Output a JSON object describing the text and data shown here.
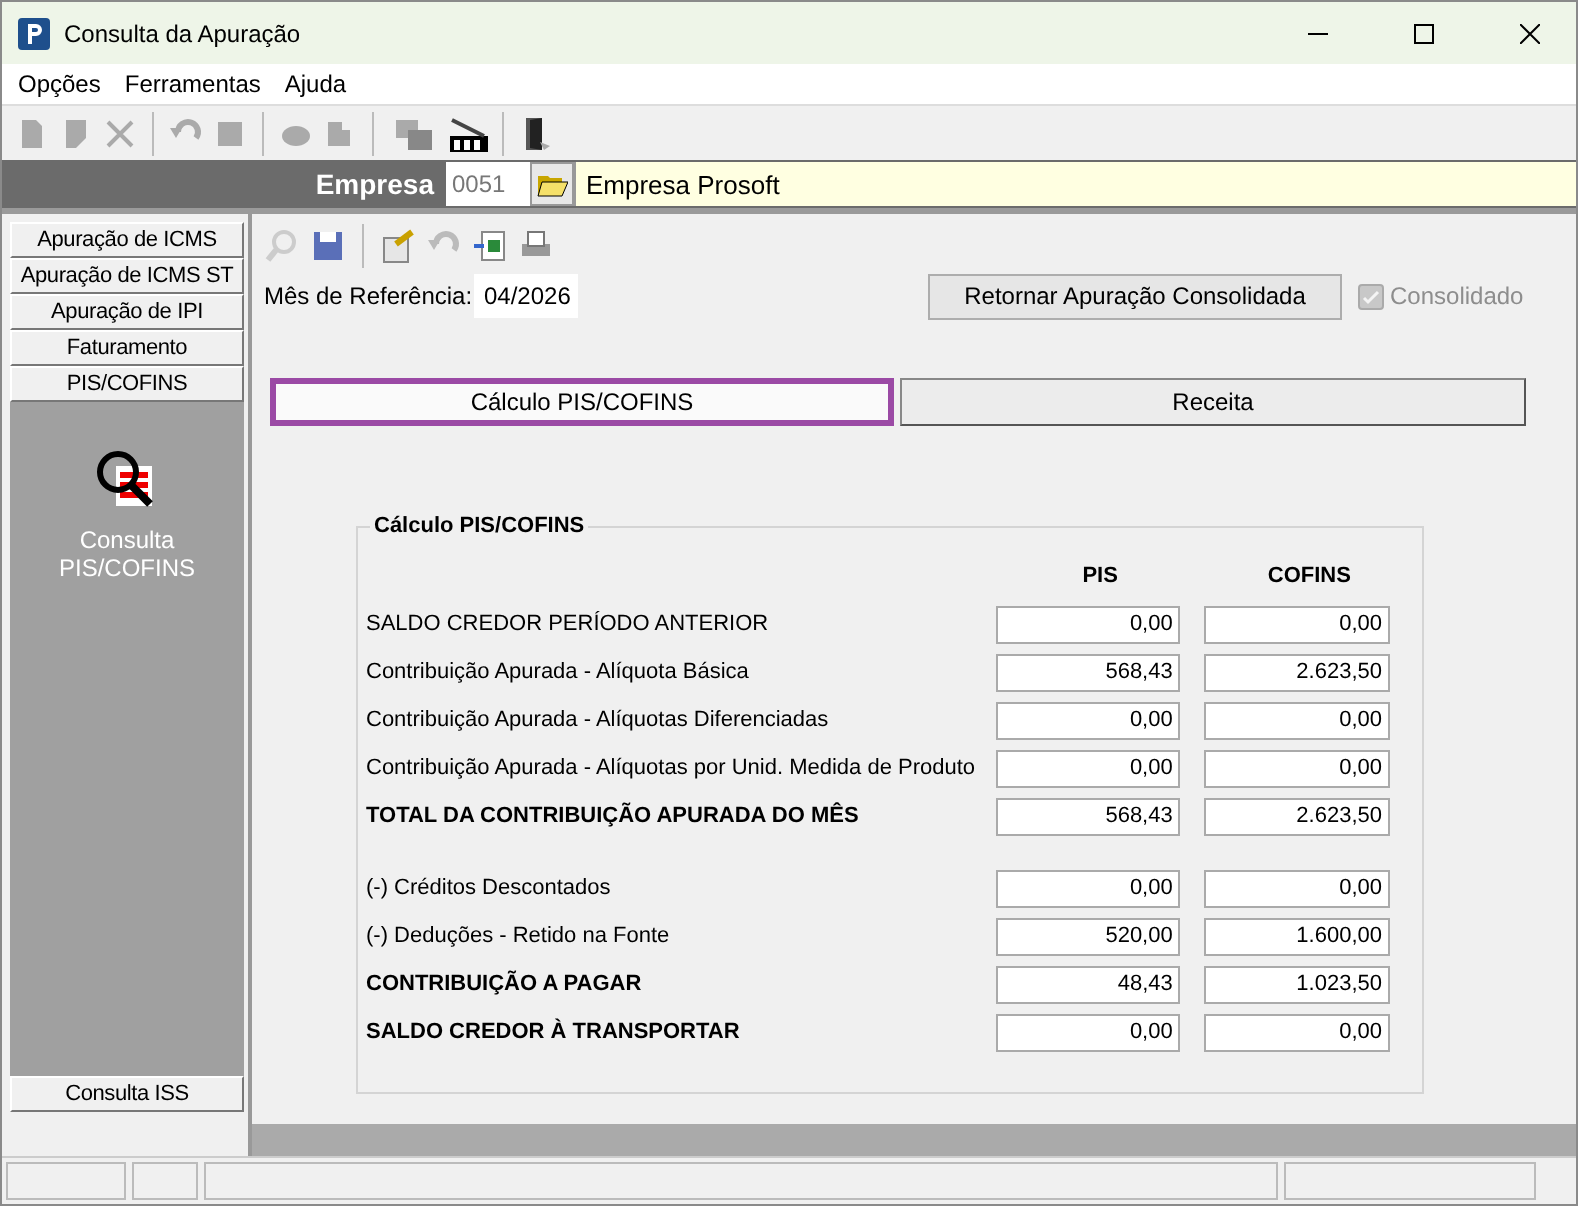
{
  "window": {
    "title": "Consulta da Apuração"
  },
  "menu": [
    "Opções",
    "Ferramentas",
    "Ajuda"
  ],
  "company": {
    "label": "Empresa",
    "code": "0051",
    "name": "Empresa Prosoft"
  },
  "sidebar": {
    "items": [
      "Apuração de ICMS",
      "Apuração de ICMS ST",
      "Apuração de IPI",
      "Faturamento",
      "PIS/COFINS"
    ],
    "panel_items": [
      {
        "label": "Consulta PIS/COFINS"
      }
    ],
    "bottom_items": [
      "Consulta ISS"
    ]
  },
  "reference": {
    "label": "Mês de Referência:",
    "value": "04/2026"
  },
  "return_button": "Retornar Apuração Consolidada",
  "consolidated": {
    "label": "Consolidado",
    "checked": true,
    "disabled": true
  },
  "tabs": [
    {
      "label": "Cálculo PIS/COFINS",
      "selected": true
    },
    {
      "label": "Receita",
      "selected": false
    }
  ],
  "group": {
    "title": "Cálculo PIS/COFINS",
    "columns": [
      "PIS",
      "COFINS"
    ],
    "sections": [
      [
        {
          "label": "SALDO CREDOR PERÍODO ANTERIOR",
          "kind": "normal",
          "pis": "0,00",
          "cofins": "0,00"
        },
        {
          "label": "Contribuição Apurada - Alíquota Básica",
          "kind": "normal",
          "pis": "568,43",
          "cofins": "2.623,50"
        },
        {
          "label": "Contribuição Apurada - Alíquotas Diferenciadas",
          "kind": "normal",
          "pis": "0,00",
          "cofins": "0,00"
        },
        {
          "label": "Contribuição Apurada - Alíquotas por Unid. Medida de Produto",
          "kind": "normal",
          "pis": "0,00",
          "cofins": "0,00"
        },
        {
          "label": "TOTAL DA CONTRIBUIÇÃO APURADA DO MÊS",
          "kind": "total",
          "pis": "568,43",
          "cofins": "2.623,50"
        }
      ],
      [
        {
          "label": "(-) Créditos Descontados",
          "kind": "normal",
          "pis": "0,00",
          "cofins": "0,00"
        },
        {
          "label": "(-) Deduções - Retido na Fonte",
          "kind": "normal",
          "pis": "520,00",
          "cofins": "1.600,00"
        },
        {
          "label": "CONTRIBUIÇÃO A PAGAR",
          "kind": "total",
          "pis": "48,43",
          "cofins": "1.023,50"
        },
        {
          "label": "SALDO CREDOR À TRANSPORTAR",
          "kind": "total",
          "pis": "0,00",
          "cofins": "0,00"
        }
      ]
    ]
  }
}
